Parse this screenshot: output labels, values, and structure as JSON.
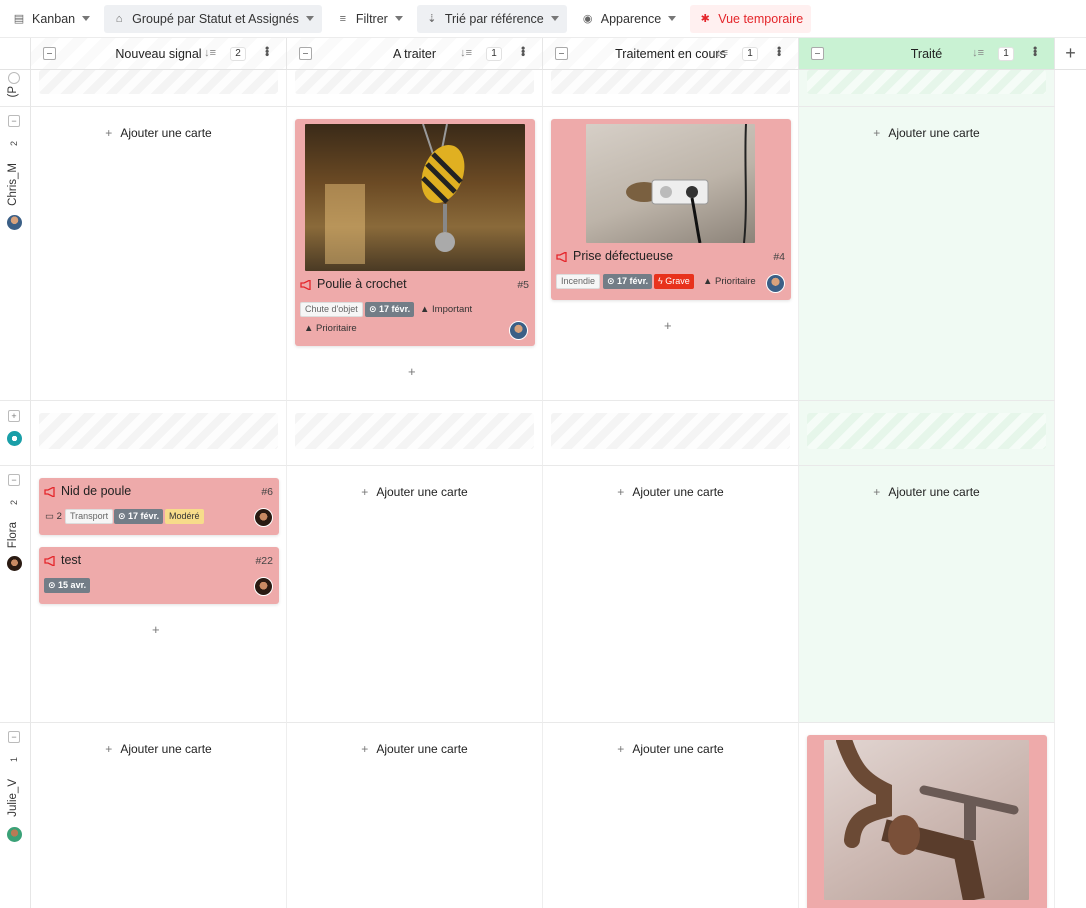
{
  "toolbar": {
    "view_label": "Kanban",
    "group_label": "Groupé par Statut et Assignés",
    "filter_label": "Filtrer",
    "sort_label": "Trié par référence",
    "appearance_label": "Apparence",
    "temp_label": "Vue temporaire"
  },
  "columns": [
    {
      "title": "Nouveau signal",
      "count": "2"
    },
    {
      "title": "A traiter",
      "count": "1"
    },
    {
      "title": "Traitement en cours",
      "count": "1"
    },
    {
      "title": "Traité",
      "count": "1"
    }
  ],
  "lanes": [
    {
      "name": "(P",
      "count": ""
    },
    {
      "name": "Chris_M",
      "count": "2"
    },
    {
      "name": "",
      "count": ""
    },
    {
      "name": "Flora",
      "count": "2"
    },
    {
      "name": "Julie_V",
      "count": "1"
    }
  ],
  "add_card_label": "Ajouter une carte",
  "cards": {
    "poulie": {
      "title": "Poulie à crochet",
      "ref": "#5",
      "tag_category": "Chute d'objet",
      "date": "17 févr.",
      "priority1": "Important",
      "priority2": "Prioritaire"
    },
    "prise": {
      "title": "Prise défectueuse",
      "ref": "#4",
      "tag_category": "Incendie",
      "date": "17 févr.",
      "severity": "Grave",
      "priority": "Prioritaire"
    },
    "nid": {
      "title": "Nid de poule",
      "ref": "#6",
      "comments": "2",
      "tag_category": "Transport",
      "date": "17 févr.",
      "severity": "Modéré"
    },
    "test": {
      "title": "test",
      "ref": "#22",
      "date": "15 avr."
    }
  },
  "colors": {
    "card": "#eeaaaa",
    "green_col": "#c9f2d3",
    "accent_red": "#e4262b"
  }
}
